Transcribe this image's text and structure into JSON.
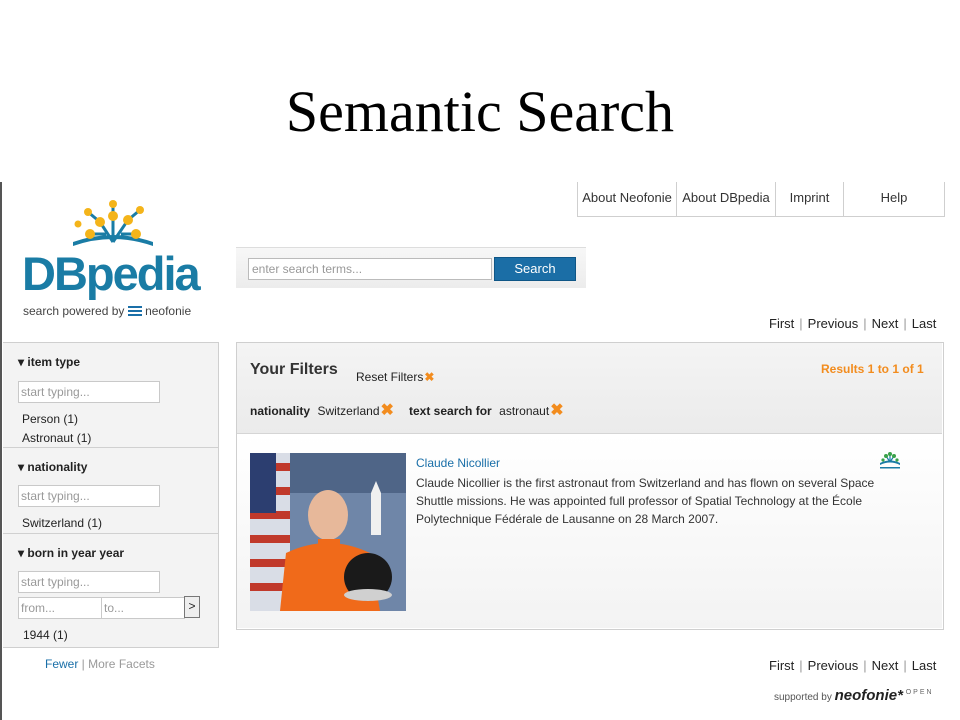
{
  "slide": {
    "title": "Semantic Search"
  },
  "topnav": {
    "items": [
      "About Neofonie",
      "About DBpedia",
      "Imprint",
      "Help"
    ]
  },
  "logo": {
    "wordmark": "DBpedia",
    "sub_prefix": "search powered by",
    "sub_brand": "neofonie"
  },
  "search": {
    "placeholder": "enter search terms...",
    "button_label": "Search"
  },
  "pager": {
    "first": "First",
    "previous": "Previous",
    "next": "Next",
    "last": "Last"
  },
  "facets": {
    "item_type": {
      "title": "item type",
      "placeholder": "start typing...",
      "values": [
        "Person (1)",
        "Astronaut (1)"
      ]
    },
    "nationality": {
      "title": "nationality",
      "placeholder": "start typing...",
      "values": [
        "Switzerland (1)"
      ]
    },
    "born": {
      "title": "born in year year",
      "placeholder": "start typing...",
      "from_placeholder": "from...",
      "to_placeholder": "to...",
      "go_label": ">",
      "values": [
        "1944 (1)"
      ]
    },
    "fewer": "Fewer",
    "more": "More Facets"
  },
  "filters": {
    "heading": "Your Filters",
    "reset": "Reset Filters",
    "results": "Results 1 to 1 of 1",
    "active": [
      {
        "label": "nationality",
        "value": "Switzerland"
      },
      {
        "label": "text search for",
        "value": "astronaut"
      }
    ]
  },
  "result": {
    "title": "Claude Nicollier",
    "description": "Claude Nicollier is the first astronaut from Switzerland and has flown on several Space Shuttle missions. He was appointed full professor of Spatial Technology at the École Polytechnique Fédérale de Lausanne on 28 March 2007."
  },
  "footer": {
    "supported_by": "supported by",
    "brand": "neofonie",
    "open": "OPEN"
  },
  "colors": {
    "accent_blue": "#1a6fa8",
    "accent_orange": "#f28c1e",
    "button_blue": "#1b6ea6"
  }
}
